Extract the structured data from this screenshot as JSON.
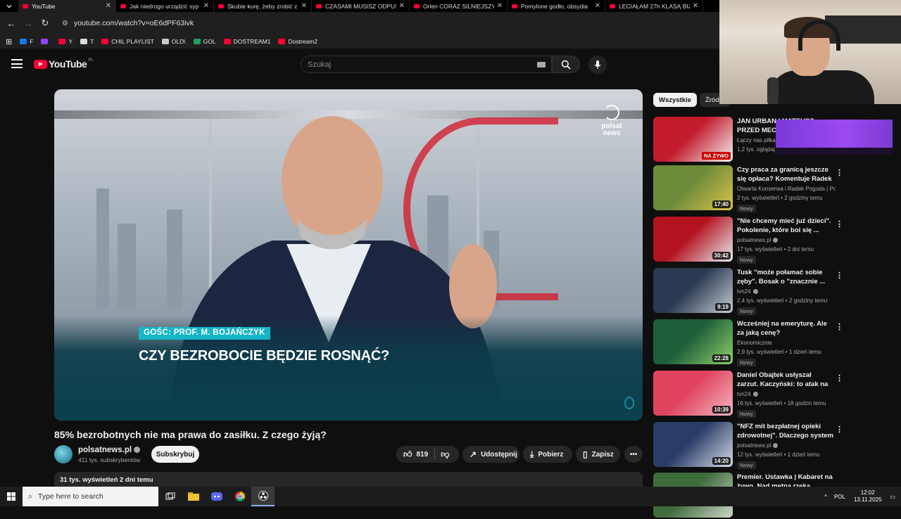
{
  "browser": {
    "tabs": [
      {
        "title": "YouTube",
        "active": true
      },
      {
        "title": "Jak niedrogo urządzić syp"
      },
      {
        "title": "Skubie kurę, żeby zrobić z"
      },
      {
        "title": "CZASAMI MUSISZ ODPUS"
      },
      {
        "title": "Orlen CORAZ SILNIEJSZY"
      },
      {
        "title": "Pomylone godło, obsydia"
      },
      {
        "title": "LECIAŁAM 27h KLASĄ BIZ"
      }
    ],
    "url": "youtube.com/watch?v=oE6dPF63ivk",
    "bookmarks": [
      {
        "label": "F",
        "color": "#1877f2"
      },
      {
        "label": "",
        "color": "#9146ff"
      },
      {
        "label": "Y",
        "color": "#ff0033"
      },
      {
        "label": "T",
        "color": "#dddddd"
      },
      {
        "label": "CHIL PLAYLIST",
        "color": "#ff0033"
      },
      {
        "label": "OLD\\",
        "color": "#cccccc"
      },
      {
        "label": "GOL",
        "color": "#1aa260"
      },
      {
        "label": "DOSTREAM1",
        "color": "#ff0033"
      },
      {
        "label": "Dostream2",
        "color": "#ff0033"
      }
    ]
  },
  "youtube": {
    "logo_text": "YouTube",
    "country_code": "PL",
    "search_placeholder": "Szukaj"
  },
  "player": {
    "guest_tag": "GOŚĆ: PROF. M. BOJAŃCZYK",
    "headline": "CZY BEZROBOCIE BĘDZIE ROSNĄĆ?",
    "brand_line1": "polsat",
    "brand_line2": "news"
  },
  "video": {
    "title": "85% bezrobotnych nie ma prawa do zasiłku. Z czego żyją?",
    "channel": "polsatnews.pl",
    "subscribers": "411 tys. subskrybentów",
    "subscribe_label": "Subskrybuj",
    "likes": "819",
    "share_label": "Udostępnij",
    "download_label": "Pobierz",
    "save_label": "Zapisz",
    "description_meta": "31 tys. wyświetleń  2 dni temu"
  },
  "chips": [
    "Wszystkie",
    "Źródło"
  ],
  "recommendations": [
    {
      "title": "JAN URBAN I MATEUSZ PRZED MECZ",
      "channel": "Łączy nas piłka",
      "meta": "1,2 tys. oglądaj",
      "live": "NA ŻYWO",
      "duration": "",
      "badge": "",
      "thumb": [
        "#c21b2c",
        "#f4f4f4"
      ]
    },
    {
      "title": "Czy praca za granicą jeszcze się opłaca? Komentuje Radek ...",
      "channel": "Otwarta Konserwa i Radek Pogoda | Pog...",
      "meta": "2 tys. wyświetleń • 2 godziny temu",
      "duration": "17:40",
      "badge": "Nowy",
      "thumb": [
        "#6d8a3a",
        "#d9c44a"
      ]
    },
    {
      "title": "\"Nie chcemy mieć już dzieci\". Pokolenie, które boi się ...",
      "channel": "polsatnews.pl",
      "meta": "17 tys. wyświetleń • 2 dni temu",
      "duration": "30:42",
      "badge": "Nowy",
      "thumb": [
        "#b3131e",
        "#e9eef4"
      ]
    },
    {
      "title": "Tusk \"może połamać sobie zęby\". Bosak o \"znacznie ...",
      "channel": "tvn24",
      "meta": "2,4 tys. wyświetleń • 2 godziny temu",
      "duration": "9:19",
      "badge": "Nowy",
      "thumb": [
        "#2b3a52",
        "#c8ccd2"
      ]
    },
    {
      "title": "Wcześniej na emeryturę. Ale za jaką cenę?",
      "channel": "Ekonomicznie",
      "meta": "2,9 tys. wyświetleń • 1 dzień temu",
      "duration": "22:28",
      "badge": "Nowy",
      "thumb": [
        "#1f5e3a",
        "#8fd16a"
      ]
    },
    {
      "title": "Daniel Obajtek usłyszał zarzut. Kaczyński: to atak na ...",
      "channel": "tvn24",
      "meta": "16 tys. wyświetleń • 18 godzin temu",
      "duration": "10:39",
      "badge": "Nowy",
      "thumb": [
        "#e0445e",
        "#f2b7c1"
      ]
    },
    {
      "title": "\"NFZ mit bezpłatnej opieki zdrowotnej\". Dlaczego system ...",
      "channel": "polsatnews.pl",
      "meta": "12 tys. wyświetleń • 1 dzień temu",
      "duration": "14:20",
      "badge": "Nowy",
      "thumb": [
        "#2a3d66",
        "#d7dde6"
      ]
    },
    {
      "title": "Premier. Ustawka | Kabaret na żywo. Nad mętną rzeką",
      "channel": "",
      "meta": "",
      "duration": "",
      "badge": "",
      "thumb": [
        "#3f6b3d",
        "#cfd6c8"
      ]
    }
  ],
  "taskbar": {
    "search_placeholder": "Type here to search",
    "lang": "POL",
    "time": "12:02",
    "date": "13.11.2025"
  }
}
